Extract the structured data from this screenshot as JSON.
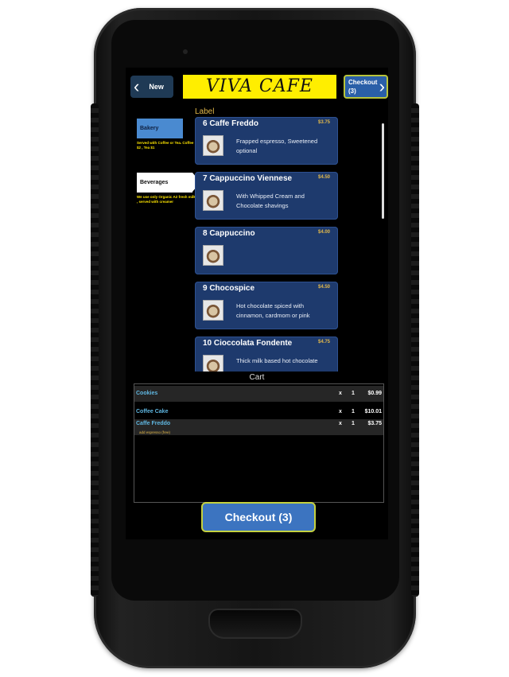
{
  "header": {
    "new_label": "New",
    "title": "VIVA CAFE",
    "checkout_label": "Checkout",
    "checkout_count": "(3)"
  },
  "menu_label": "Label",
  "categories": [
    {
      "name": "Bakery",
      "desc": "Served with Coffee or Tea. Coffee $2 , Tea $1"
    },
    {
      "name": "Beverages",
      "desc": "We use only Organic A2 fresh milk , served with creamer"
    }
  ],
  "menu_items": [
    {
      "name": "6  Caffe Freddo",
      "price": "$3.75",
      "desc": "Frapped espresso, Sweetened optional"
    },
    {
      "name": "7  Cappuccino Viennese",
      "price": "$4.50",
      "desc": "With Whipped Cream and Chocolate shavings"
    },
    {
      "name": "8  Cappuccino",
      "price": "$4.00",
      "desc": ""
    },
    {
      "name": "9  Chocospice",
      "price": "$4.50",
      "desc": "Hot chocolate spiced with cinnamon, cardmom or pink"
    },
    {
      "name": "10  Cioccolata Fondente",
      "price": "$4.75",
      "desc": "Thick milk based hot chocolate"
    }
  ],
  "cart": {
    "title": "Cart",
    "rows": [
      {
        "item": "Cookies",
        "x": "x",
        "qty": "1",
        "amount": "$0.99",
        "modifier": ""
      },
      {
        "item": "Coffee Cake",
        "x": "x",
        "qty": "1",
        "amount": "$10.01",
        "modifier": ""
      },
      {
        "item": "Caffe Freddo",
        "x": "x",
        "qty": "1",
        "amount": "$3.75",
        "modifier": "add espresso (free)"
      }
    ]
  },
  "checkout_button": "Checkout (3)",
  "colors": {
    "title_bg": "#ffee00",
    "item_bg": "#1e3a6d",
    "accent_price": "#e2b84a",
    "cart_item_text": "#5fb6e0",
    "checkout_bg": "#3c74c0"
  }
}
